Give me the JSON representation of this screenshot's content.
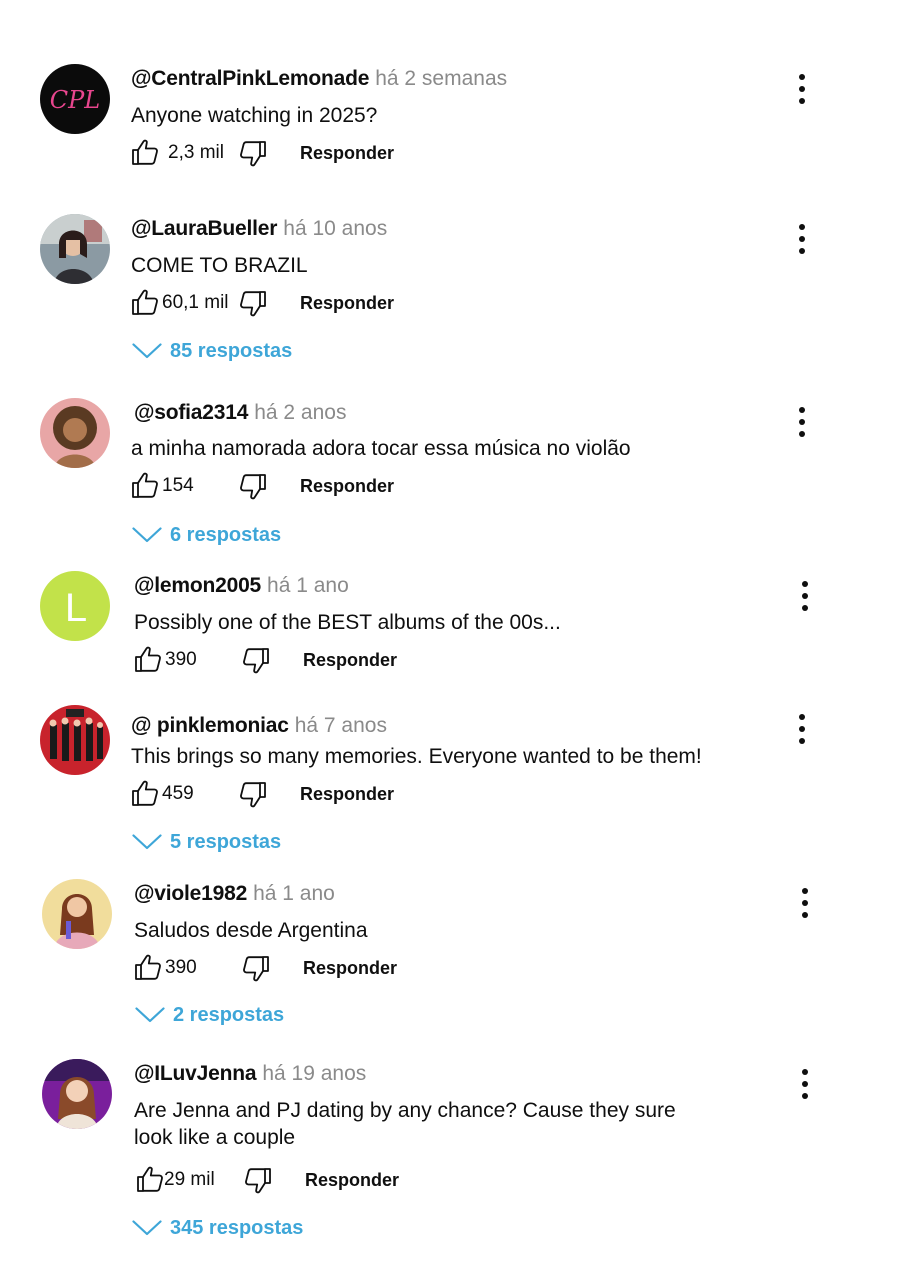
{
  "comments": [
    {
      "author": "@CentralPinkLemonade",
      "time": "há 2 semanas",
      "text_lines": [
        "Anyone watching in 2025?"
      ],
      "likes": "2,3 mil",
      "reply_label": "Responder",
      "avatar_text": "CPL"
    },
    {
      "author": "@LauraBueller",
      "time": "há 10 anos",
      "text_lines": [
        "COME TO BRAZIL"
      ],
      "likes": "60,1 mil",
      "reply_label": "Responder",
      "replies": "85 respostas"
    },
    {
      "author": "@sofia2314",
      "time": "há 2 anos",
      "text_lines": [
        "a minha namorada adora tocar essa música no violão"
      ],
      "likes": "154",
      "reply_label": "Responder",
      "replies": "6 respostas"
    },
    {
      "author": "@lemon2005",
      "time": "há 1 ano",
      "text_lines": [
        "Possibly one of the BEST albums of the 00s..."
      ],
      "likes": "390",
      "reply_label": "Responder",
      "avatar_text": "L"
    },
    {
      "author": "@ pinklemoniac",
      "time": "há 7 anos",
      "text_lines": [
        "This brings so many memories. Everyone wanted to be them!"
      ],
      "likes": "459",
      "reply_label": "Responder",
      "replies": "5 respostas"
    },
    {
      "author": "@viole1982",
      "time": "há 1 ano",
      "text_lines": [
        "Saludos desde Argentina"
      ],
      "likes": "390",
      "reply_label": "Responder",
      "replies": "2 respostas"
    },
    {
      "author": "@ILuvJenna",
      "time": "há 19 anos",
      "text_lines": [
        "Are Jenna and PJ dating by any chance? Cause they sure",
        "look like a couple"
      ],
      "likes": "29 mil",
      "reply_label": "Responder",
      "replies": "345 respostas"
    }
  ],
  "colors": {
    "replies_link": "#3ea6d8",
    "time_text": "#8a8a8a",
    "lemon_avatar": "#c2e24a"
  },
  "icons": {
    "like": "thumbs-up-icon",
    "dislike": "thumbs-down-icon",
    "menu": "more-vertical-icon",
    "expand": "chevron-down-icon"
  }
}
